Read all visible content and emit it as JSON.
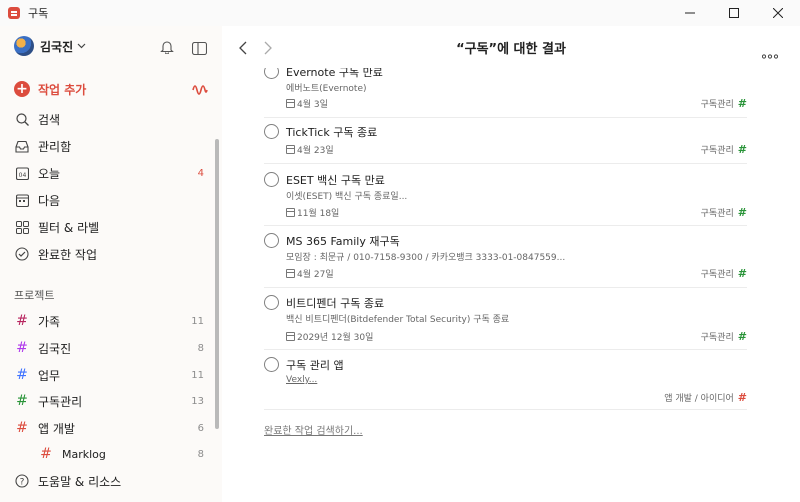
{
  "window": {
    "title": "구독"
  },
  "sidebar": {
    "user_name": "김국진",
    "nav": [
      {
        "label": "작업 추가",
        "icon": "add-task-icon"
      },
      {
        "label": "검색",
        "icon": "search-icon"
      },
      {
        "label": "관리함",
        "icon": "inbox-icon"
      },
      {
        "label": "오늘",
        "icon": "today-icon",
        "count": "4"
      },
      {
        "label": "다음",
        "icon": "upcoming-icon"
      },
      {
        "label": "필터 & 라벨",
        "icon": "filters-icon"
      },
      {
        "label": "완료한 작업",
        "icon": "completed-icon"
      }
    ],
    "projects_title": "프로젝트",
    "projects": [
      {
        "name": "가족",
        "count": "11",
        "color": "#b8255f"
      },
      {
        "name": "김국진",
        "count": "8",
        "color": "#af38eb"
      },
      {
        "name": "업무",
        "count": "11",
        "color": "#4073ff"
      },
      {
        "name": "구독관리",
        "count": "13",
        "color": "#299438"
      },
      {
        "name": "앱 개발",
        "count": "6",
        "color": "#dc4c3e"
      },
      {
        "name": "Marklog",
        "count": "8",
        "color": "#dc4c3e"
      }
    ],
    "help_label": "도움말 & 리소스"
  },
  "main": {
    "title": "“구독”에 대한 결과",
    "tasks": [
      {
        "title": "Evernote 구독 만료",
        "desc": "에버노트(Evernote)",
        "date": "4월 3일",
        "project": "구독관리",
        "project_color": "#299438"
      },
      {
        "title": "TickTick 구독 종료",
        "date": "4월 23일",
        "project": "구독관리",
        "project_color": "#299438"
      },
      {
        "title": "ESET 백신 구독 만료",
        "desc": "이셋(ESET) 백신 구독 종료일...",
        "date": "11월 18일",
        "project": "구독관리",
        "project_color": "#299438"
      },
      {
        "title": "MS 365 Family 재구독",
        "desc": "모임장 : 최문규 / 010-7158-9300 / 카카오뱅크 3333-01-0847559...",
        "date": "4월 27일",
        "project": "구독관리",
        "project_color": "#299438"
      },
      {
        "title": "비트디펜더 구독 종료",
        "desc": "백신 비트디펜더(Bitdefender Total Security) 구독 종료",
        "date": "2029년 12월 30일",
        "project": "구독관리",
        "project_color": "#299438"
      },
      {
        "title": "구독 관리 앱",
        "desc": "Vexly...",
        "project": "앱 개발 / 아이디어",
        "project_color": "#dc4c3e"
      }
    ],
    "completed_link": "완료한 작업 검색하기..."
  },
  "colors": {
    "accent": "#dc4c3e"
  }
}
